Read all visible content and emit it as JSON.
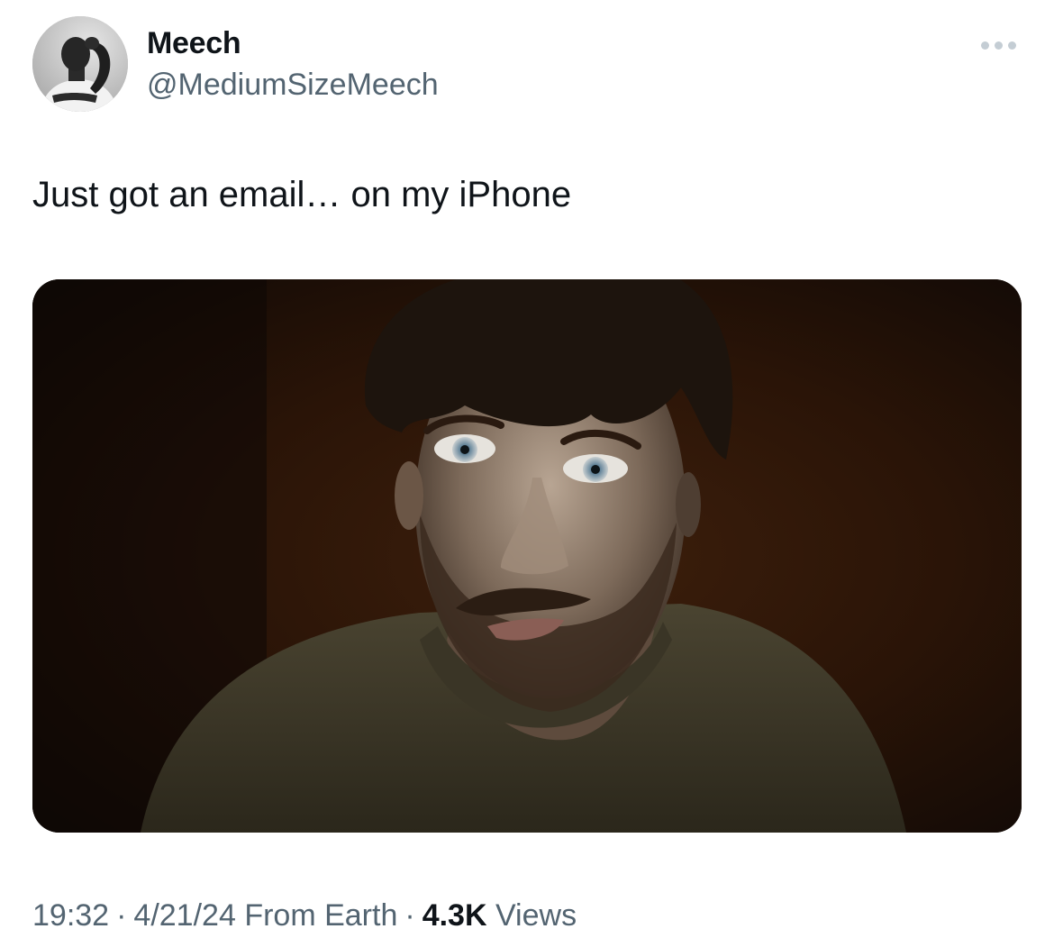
{
  "author": {
    "name": "Meech",
    "handle": "@MediumSizeMeech"
  },
  "tweet": {
    "text": "Just got an email… on my iPhone"
  },
  "meta": {
    "time": "19:32",
    "date": "4/21/24",
    "source": "From Earth",
    "separator": "·",
    "views_count": "4.3K",
    "views_label": "Views"
  },
  "icons": {
    "more": "more-horizontal-icon"
  },
  "colors": {
    "text_primary": "#0f1419",
    "text_secondary": "#536471",
    "more_dots": "#c4cdd4",
    "background": "#ffffff"
  }
}
